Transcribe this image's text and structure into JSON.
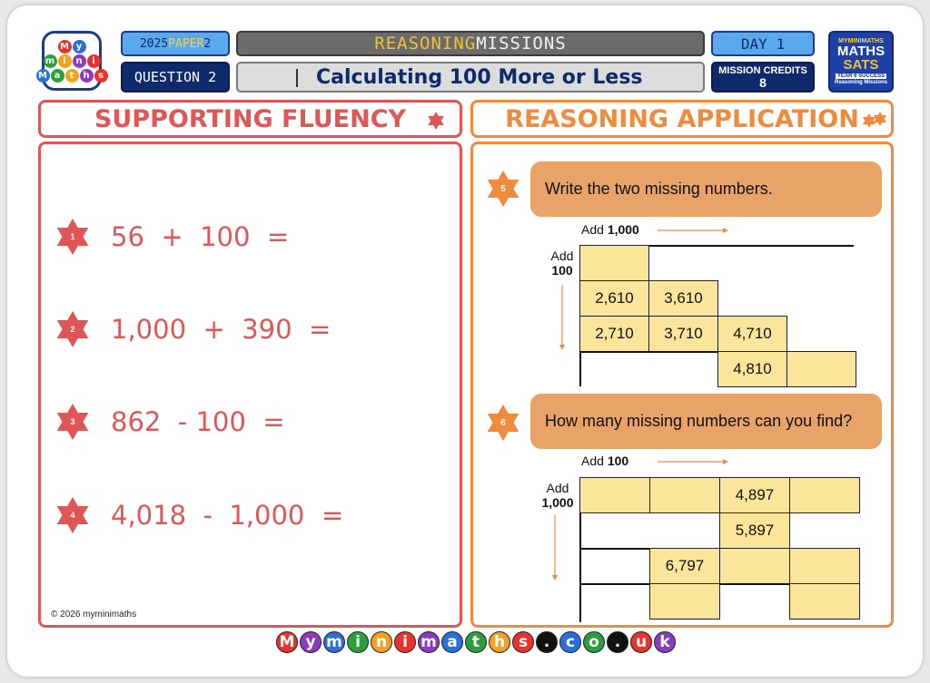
{
  "logo": {
    "rows": [
      [
        "M",
        "y"
      ],
      [
        "m",
        "i",
        "n",
        "i"
      ],
      [
        "M",
        "a",
        "t",
        "h",
        "s"
      ]
    ],
    "colors": [
      "#e8322b",
      "#2c6fd6",
      "#2e9e3c",
      "#f2a21e",
      "#8b3bbd",
      "#e8322b",
      "#2c6fd6",
      "#2e9e3c",
      "#f2a21e",
      "#8b3bbd",
      "#e8322b"
    ]
  },
  "header": {
    "paper_prefix": "2025 ",
    "paper_highlight": "PAPER",
    "paper_suffix": " 2",
    "question": "QUESTION 2",
    "title_part1": "REASONING",
    "title_part2": " MISSIONS",
    "subtitle": "Calculating 100 More or Less",
    "day": "DAY 1",
    "credits_label": "MISSION CREDITS",
    "credits_value": "8",
    "sats_badge": {
      "l1": "MYMINIMATHS",
      "l2": "MATHS",
      "l3": "SATS",
      "l4": "YEAR 6 SUCCESS",
      "l5": "Reasoning Missions"
    }
  },
  "fluency": {
    "heading": "SUPPORTING FLUENCY",
    "questions": [
      {
        "num": "1",
        "expr": "56  +  100  ="
      },
      {
        "num": "2",
        "expr": "1,000  +  390  ="
      },
      {
        "num": "3",
        "expr": "862  - 100  ="
      },
      {
        "num": "4",
        "expr": "4,018  -  1,000  ="
      }
    ],
    "copyright": "© 2026 myminimaths"
  },
  "reasoning": {
    "heading": "REASONING APPLICATION",
    "q5": {
      "num": "5",
      "text": "Write the two missing numbers.",
      "top_label_prefix": "Add ",
      "top_label_value": "1,000",
      "side_label_prefix": "Add",
      "side_label_value": "100",
      "cells": [
        "",
        "2,610",
        "3,610",
        "2,710",
        "3,710",
        "4,710",
        "4,810",
        ""
      ]
    },
    "q6": {
      "num": "6",
      "text": "How many missing numbers can you find?",
      "top_label_prefix": "Add ",
      "top_label_value": "100",
      "side_label_prefix": "Add",
      "side_label_value": "1,000",
      "cells": [
        "",
        "",
        "4,897",
        "",
        "5,897",
        "6,797",
        "",
        "",
        "",
        ""
      ]
    }
  },
  "footer": {
    "letters": [
      "M",
      "y",
      "m",
      "i",
      "n",
      "i",
      "m",
      "a",
      "t",
      "h",
      "s",
      ".",
      "c",
      "o",
      ".",
      "u",
      "k"
    ],
    "colors": [
      "#e8322b",
      "#8b3bbd",
      "#2c6fd6",
      "#2e9e3c",
      "#f2a21e",
      "#e8322b",
      "#8b3bbd",
      "#2c6fd6",
      "#2e9e3c",
      "#f2a21e",
      "#e8322b",
      "#111111",
      "#2c6fd6",
      "#2e9e3c",
      "#111111",
      "#e8322b",
      "#8b3bbd"
    ]
  },
  "colors": {
    "fluency_red": "#e05656",
    "reasoning_orange": "#f08a3c",
    "cell_yellow": "#fbe59a",
    "navy": "#0f2a6b"
  }
}
